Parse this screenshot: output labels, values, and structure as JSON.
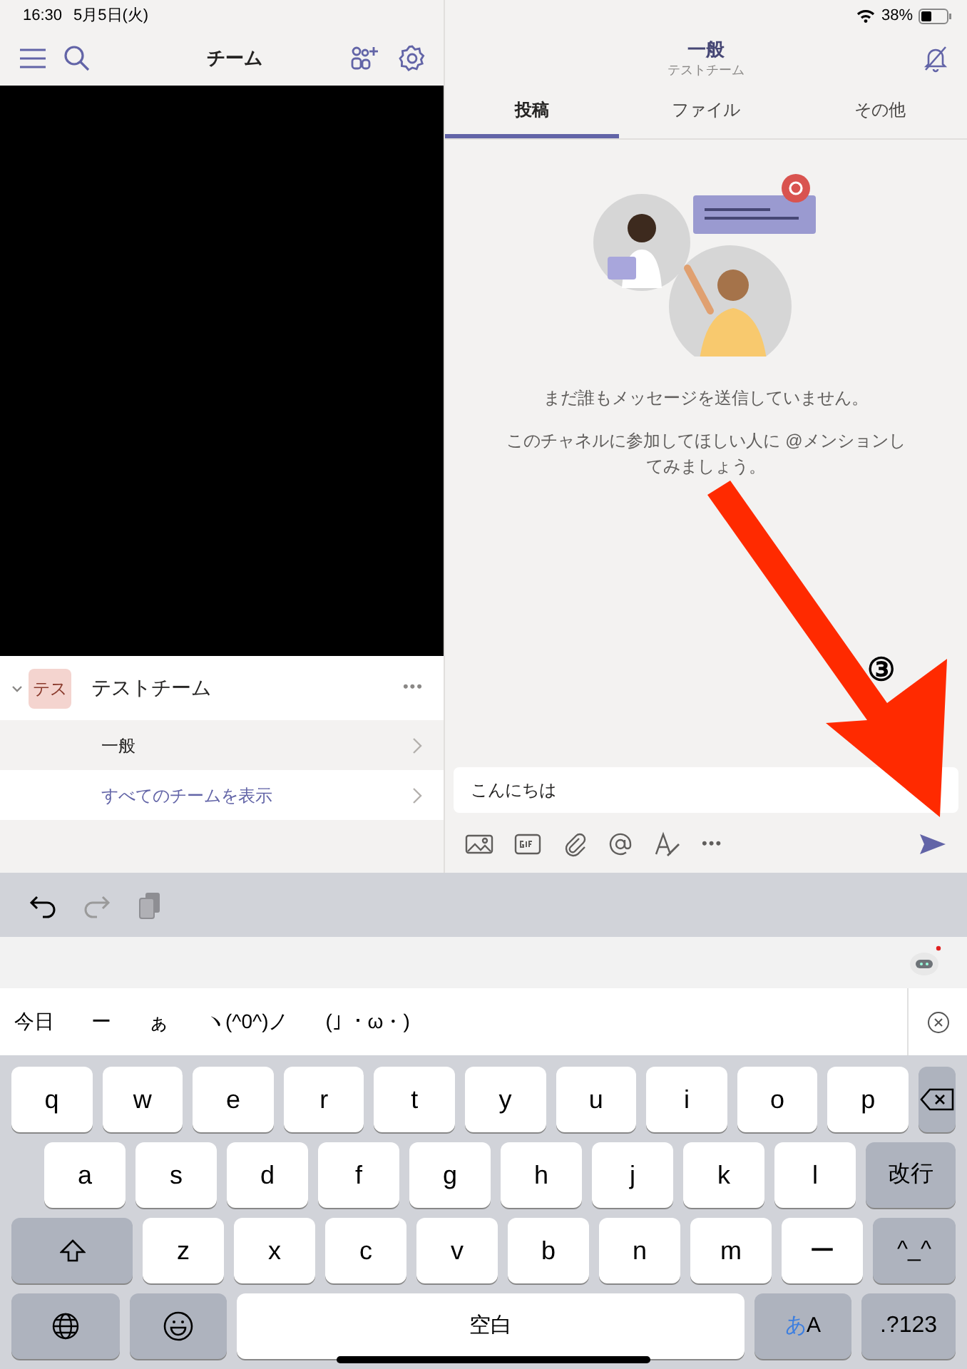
{
  "status_bar": {
    "time": "16:30",
    "date": "5月5日(火)",
    "battery": "38%"
  },
  "left_header": {
    "title": "チーム"
  },
  "teams": [
    {
      "avatar": "テス",
      "name": "テストチーム",
      "expanded": true,
      "more": "•••",
      "channels": [
        {
          "name": "一般",
          "selected": true,
          "kind": "channel"
        },
        {
          "name": "すべてのチームを表示",
          "selected": false,
          "kind": "link"
        }
      ]
    }
  ],
  "channel_header": {
    "title": "一般",
    "subtitle": "テストチーム"
  },
  "tabs": [
    {
      "label": "投稿",
      "selected": true
    },
    {
      "label": "ファイル",
      "selected": false
    },
    {
      "label": "その他",
      "selected": false
    }
  ],
  "empty_state": {
    "line_1": "まだ誰もメッセージを送信していません。",
    "line_2": "このチャネルに参加してほしい人に @メンションしてみましょう。"
  },
  "compose": {
    "value": "こんにちは",
    "more": "•••"
  },
  "annotation": {
    "label": "③"
  },
  "keyboard": {
    "candidates": [
      "今日",
      "ー",
      "ぁ",
      "ヽ(^0^)ノ",
      "(｣ ・ω・)"
    ],
    "rows": [
      {
        "keys": [
          {
            "kind": "letter",
            "label": "q"
          },
          {
            "kind": "letter",
            "label": "w"
          },
          {
            "kind": "letter",
            "label": "e"
          },
          {
            "kind": "letter",
            "label": "r"
          },
          {
            "kind": "letter",
            "label": "t"
          },
          {
            "kind": "letter",
            "label": "y"
          },
          {
            "kind": "letter",
            "label": "u"
          },
          {
            "kind": "letter",
            "label": "i"
          },
          {
            "kind": "letter",
            "label": "o"
          },
          {
            "kind": "letter",
            "label": "p"
          },
          {
            "kind": "backspace"
          }
        ]
      },
      {
        "keys": [
          {
            "kind": "letter",
            "label": "a"
          },
          {
            "kind": "letter",
            "label": "s"
          },
          {
            "kind": "letter",
            "label": "d"
          },
          {
            "kind": "letter",
            "label": "f"
          },
          {
            "kind": "letter",
            "label": "g"
          },
          {
            "kind": "letter",
            "label": "h"
          },
          {
            "kind": "letter",
            "label": "j"
          },
          {
            "kind": "letter",
            "label": "k"
          },
          {
            "kind": "letter",
            "label": "l"
          },
          {
            "kind": "action",
            "label": "改行"
          }
        ]
      },
      {
        "keys": [
          {
            "kind": "shift"
          },
          {
            "kind": "letter",
            "label": "z"
          },
          {
            "kind": "letter",
            "label": "x"
          },
          {
            "kind": "letter",
            "label": "c"
          },
          {
            "kind": "letter",
            "label": "v"
          },
          {
            "kind": "letter",
            "label": "b"
          },
          {
            "kind": "letter",
            "label": "n"
          },
          {
            "kind": "letter",
            "label": "m"
          },
          {
            "kind": "letter",
            "label": "ー"
          },
          {
            "kind": "action",
            "label": "^_^"
          }
        ]
      },
      {
        "keys": [
          {
            "kind": "globe"
          },
          {
            "kind": "emoji"
          },
          {
            "kind": "space",
            "label": "空白"
          },
          {
            "kind": "mode",
            "kana": "あ",
            "latin": "A"
          },
          {
            "kind": "action",
            "label": ".?123"
          }
        ]
      }
    ]
  }
}
